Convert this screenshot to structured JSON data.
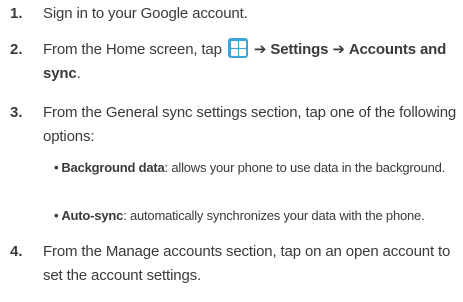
{
  "steps": [
    {
      "number": "1.",
      "text": "Sign in to your Google account."
    },
    {
      "number": "2.",
      "text_before": "From the Home screen, tap",
      "icon": "applications-grid-icon",
      "arrow": "➔",
      "menu_1": "Settings",
      "menu_2": "Accounts and sync",
      "end": "."
    },
    {
      "number": "3.",
      "text": "From the General sync settings section, tap one of the following options:"
    },
    {
      "number": "4.",
      "text": "From the Manage accounts section, tap on an open account to set the account settings."
    }
  ],
  "options": [
    {
      "bullet": "•",
      "term": "Background data",
      "description": ": allows your phone to use data in the background."
    },
    {
      "bullet": "•",
      "term": "Auto-sync",
      "description": ": automatically synchronizes your data with the phone."
    }
  ],
  "colors": {
    "text": "#3a3a3a",
    "icon": "#3aa6d8"
  }
}
